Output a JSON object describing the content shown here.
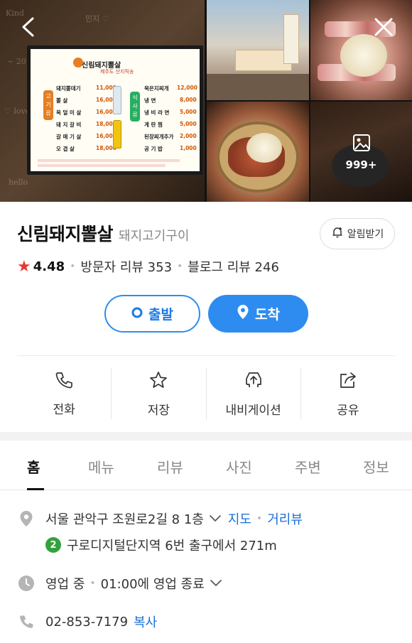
{
  "photos": {
    "more_count": "999+",
    "board": {
      "title": "신림돼지뽈살",
      "subtitle": "제주도 산지직송",
      "cat_left": "고기류",
      "cat_right": "식사류",
      "left_items": [
        {
          "name": "돼지뽈데기",
          "price": "11,000"
        },
        {
          "name": "뽈    살",
          "price": "16,000"
        },
        {
          "name": "목 덜 미 살",
          "price": "16,000"
        },
        {
          "name": "돼 지 갈 비",
          "price": "18,000"
        },
        {
          "name": "갈 매 기 살",
          "price": "16,000"
        },
        {
          "name": "오    겹    살",
          "price": "18,000"
        }
      ],
      "right_items": [
        {
          "name": "묵은지찌개",
          "price": "12,000"
        },
        {
          "name": "냉    면",
          "price": "8,000"
        },
        {
          "name": "냉 비 라 면",
          "price": "5,000"
        },
        {
          "name": "계 란 찜",
          "price": "5,000"
        },
        {
          "name": "된장찌개추가",
          "price": "2,000"
        },
        {
          "name": "공 기 밥",
          "price": "1,000"
        }
      ]
    }
  },
  "place": {
    "name": "신림돼지뽈살",
    "category": "돼지고기구이",
    "alarm_label": "알림받기",
    "rating": "4.48",
    "visitor_reviews": "방문자 리뷰 353",
    "blog_reviews": "블로그 리뷰 246"
  },
  "route": {
    "depart": "출발",
    "arrive": "도착",
    "accent": "#2e8cf0"
  },
  "actions": [
    {
      "label": "전화",
      "icon": "phone-icon"
    },
    {
      "label": "저장",
      "icon": "star-icon"
    },
    {
      "label": "내비게이션",
      "icon": "navigation-icon"
    },
    {
      "label": "공유",
      "icon": "share-icon"
    }
  ],
  "tabs": [
    "홈",
    "메뉴",
    "리뷰",
    "사진",
    "주변",
    "정보"
  ],
  "active_tab": "홈",
  "info": {
    "address": "서울 관악구 조원로2길 8 1층",
    "map_link": "지도",
    "street_link": "거리뷰",
    "subway_line": "2",
    "subway_text": "구로디지털단지역 6번 출구에서 271m",
    "hours_status": "영업 중",
    "hours_text": "01:00에 영업 종료",
    "phone": "02-853-7179",
    "copy_label": "복사"
  }
}
